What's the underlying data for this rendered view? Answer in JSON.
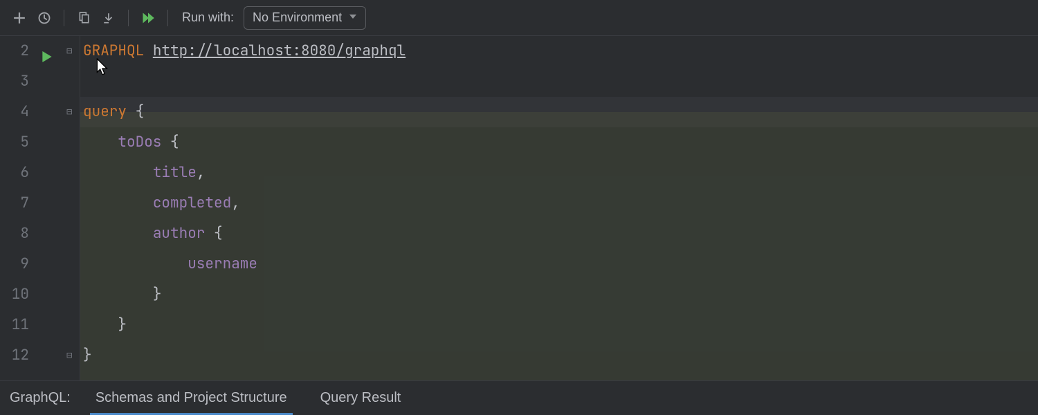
{
  "toolbar": {
    "run_with_label": "Run with:",
    "environment_selected": "No Environment"
  },
  "gutter": {
    "start": 2,
    "lines": [
      "2",
      "3",
      "4",
      "5",
      "6",
      "7",
      "8",
      "9",
      "10",
      "11",
      "12"
    ]
  },
  "code": {
    "request_type": "GRAPHQL",
    "url": "http://localhost:8080/graphql",
    "lines": [
      {
        "type": "header"
      },
      {
        "type": "blank"
      },
      {
        "type": "raw",
        "tokens": [
          [
            "k-kw",
            "query"
          ],
          [
            "k-brace",
            " {"
          ]
        ]
      },
      {
        "type": "raw",
        "tokens": [
          [
            "sp",
            "    "
          ],
          [
            "k-field",
            "toDos"
          ],
          [
            "k-brace",
            " {"
          ]
        ]
      },
      {
        "type": "raw",
        "tokens": [
          [
            "sp",
            "        "
          ],
          [
            "k-field",
            "title"
          ],
          [
            "k-punct",
            ","
          ]
        ]
      },
      {
        "type": "raw",
        "tokens": [
          [
            "sp",
            "        "
          ],
          [
            "k-field",
            "completed"
          ],
          [
            "k-punct",
            ","
          ]
        ]
      },
      {
        "type": "raw",
        "tokens": [
          [
            "sp",
            "        "
          ],
          [
            "k-field",
            "author"
          ],
          [
            "k-brace",
            " {"
          ]
        ]
      },
      {
        "type": "raw",
        "tokens": [
          [
            "sp",
            "            "
          ],
          [
            "k-field",
            "username"
          ]
        ]
      },
      {
        "type": "raw",
        "tokens": [
          [
            "sp",
            "        "
          ],
          [
            "k-brace",
            "}"
          ]
        ]
      },
      {
        "type": "raw",
        "tokens": [
          [
            "sp",
            "    "
          ],
          [
            "k-brace",
            "}"
          ]
        ]
      },
      {
        "type": "raw",
        "tokens": [
          [
            "k-brace",
            "}"
          ]
        ]
      }
    ]
  },
  "bottom": {
    "panel_label": "GraphQL:",
    "tabs": [
      "Schemas and Project Structure",
      "Query Result"
    ],
    "active_index": 0
  }
}
